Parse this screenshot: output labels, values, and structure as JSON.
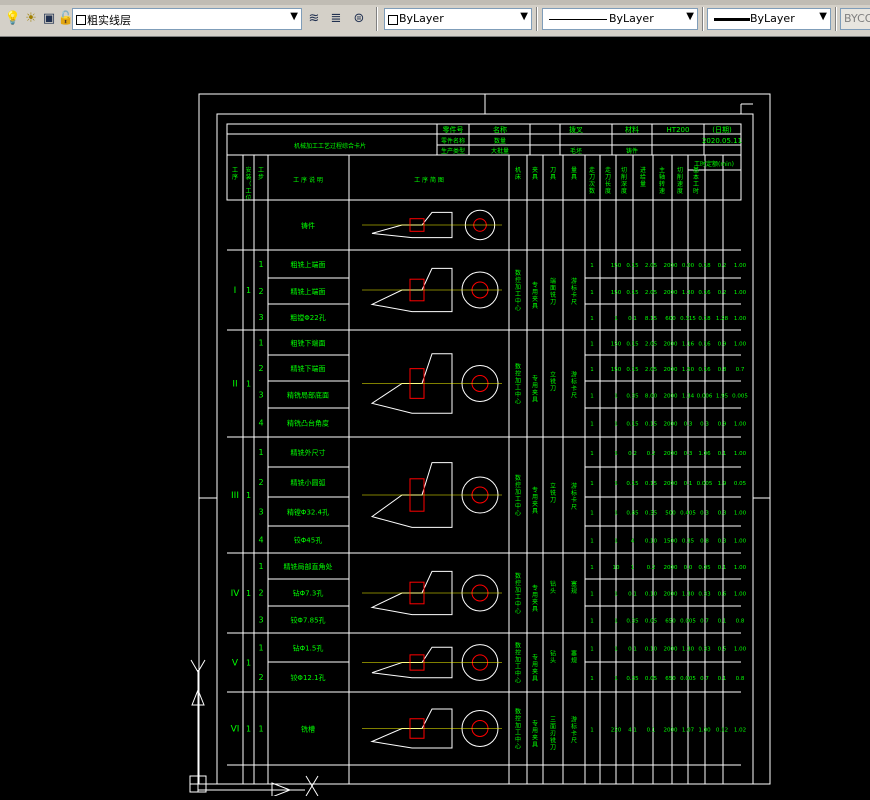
{
  "toolbar": {
    "layer_name": "粗实线层",
    "color_value": "ByLayer",
    "linetype_value": "ByLayer",
    "lineweight_value": "ByLayer",
    "plotstyle_value": "BYCOL",
    "icons": [
      "lightbulb-icon",
      "sun-icon",
      "freeze-viewport-icon",
      "lock-icon",
      "color-swatch-icon",
      "layer-properties-icon",
      "layer-previous-icon",
      "make-current-icon"
    ]
  },
  "drawing": {
    "info_box": {
      "r1": [
        "零件号",
        "名称",
        "拨叉",
        "材料",
        "HT200",
        "(日期)"
      ],
      "r2": [
        "零件名称",
        "数量",
        "2020.05.11"
      ],
      "r3": [
        "生产类型",
        "大批量",
        "毛坯",
        "铸件"
      ]
    },
    "sheet_title": "机械加工工艺过程综合卡片",
    "headers": [
      "工序",
      "安装（工位）",
      "工步",
      "工 序 说 明",
      "工 序 简 图",
      "机床",
      "夹具",
      "刀具",
      "量具",
      "走刀次数",
      "走刀长度",
      "切削深度",
      "进给量",
      "主轴转速",
      "切削速度",
      "基本工时"
    ],
    "time_header": "工时定额(min)",
    "procedures": [
      {
        "op": "",
        "setup": "",
        "steps": [
          {
            "num": "",
            "desc": "铸件"
          }
        ],
        "machine": "",
        "fixture": "",
        "tool": "",
        "gauge": ""
      },
      {
        "op": "I",
        "setup": "1",
        "steps": [
          {
            "num": "1",
            "desc": "粗铣上端面",
            "vals": [
              "1",
              "150",
              "0.15",
              "2.05",
              "2000",
              "0.00",
              "0.18",
              "0.2",
              "1.00"
            ]
          },
          {
            "num": "2",
            "desc": "精铣上端面",
            "vals": [
              "1",
              "150",
              "0.15",
              "2.05",
              "2000",
              "1.30",
              "0.16",
              "0.2",
              "1.00"
            ]
          },
          {
            "num": "3",
            "desc": "粗镗Φ22孔",
            "vals": [
              "1",
              "1",
              "0.1",
              "8.15",
              "600",
              "0.315",
              "0.18",
              "1.28",
              "1.00"
            ]
          }
        ],
        "machine": "数控加工中心",
        "fixture": "专用夹具",
        "tool": "端面铣刀",
        "gauge": "游标卡尺"
      },
      {
        "op": "II",
        "setup": "1",
        "steps": [
          {
            "num": "1",
            "desc": "粗铣下端面",
            "vals": [
              "1",
              "150",
              "0.15",
              "2.05",
              "2000",
              "1.16",
              "0.16",
              "0.9",
              "1.00"
            ]
          },
          {
            "num": "2",
            "desc": "精铣下端面",
            "vals": [
              "1",
              "150",
              "0.15",
              "2.05",
              "2000",
              "1.50",
              "0.16",
              "0.8",
              "0.7"
            ]
          },
          {
            "num": "3",
            "desc": "精铣局部底面",
            "vals": [
              "1",
              "1",
              "0.35",
              "8.00",
              "2000",
              "1.34",
              "0.006",
              "1.95",
              "0.005"
            ]
          },
          {
            "num": "4",
            "desc": "精铣凸台角度",
            "vals": [
              "1",
              "1",
              "0.15",
              "0.15",
              "2000",
              "0.3",
              "0.3",
              "0.9",
              "1.00"
            ]
          }
        ],
        "machine": "数控加工中心",
        "fixture": "专用夹具",
        "tool": "立铣刀",
        "gauge": "游标卡尺"
      },
      {
        "op": "III",
        "setup": "1",
        "steps": [
          {
            "num": "1",
            "desc": "精铣外尺寸",
            "vals": [
              "1",
              "1",
              "0.2",
              "0.2",
              "2000",
              "0.3",
              "1.06",
              "0.1",
              "1.00"
            ]
          },
          {
            "num": "2",
            "desc": "精铣小圆弧",
            "vals": [
              "1",
              "1",
              "0.15",
              "0.15",
              "2000",
              "0.1",
              "0.005",
              "1.9",
              "0.05"
            ]
          },
          {
            "num": "3",
            "desc": "精镗Φ32.4孔",
            "vals": [
              "1",
              "1",
              "0.45",
              "0.35",
              "500",
              "0.405",
              "0.3",
              "0.3",
              "1.00"
            ]
          },
          {
            "num": "4",
            "desc": "铰Φ45孔",
            "vals": [
              "1",
              "1",
              "4",
              "0.10",
              "1500",
              "0.35",
              "0.8",
              "0.3",
              "1.00"
            ]
          }
        ],
        "machine": "数控加工中心",
        "fixture": "专用夹具",
        "tool": "立铣刀",
        "gauge": "游标卡尺"
      },
      {
        "op": "IV",
        "setup": "1",
        "steps": [
          {
            "num": "1",
            "desc": "精铣局部直角处",
            "vals": [
              "1",
              "10",
              "1",
              "0.2",
              "2000",
              "0.0",
              "0.05",
              "0.1",
              "1.00"
            ]
          },
          {
            "num": "2",
            "desc": "钻Φ7.3孔",
            "vals": [
              "1",
              "1",
              "0.1",
              "0.10",
              "2000",
              "1.30",
              "0.33",
              "0.6",
              "1.00"
            ]
          },
          {
            "num": "3",
            "desc": "铰Φ7.85孔",
            "vals": [
              "1",
              "1",
              "0.35",
              "0.05",
              "650",
              "0.005",
              "0.7",
              "0.1",
              "0.8"
            ]
          }
        ],
        "machine": "数控加工中心",
        "fixture": "专用夹具",
        "tool": "钻头",
        "gauge": "塞规"
      },
      {
        "op": "V",
        "setup": "1",
        "steps": [
          {
            "num": "1",
            "desc": "钻Φ1.5孔",
            "vals": [
              "1",
              "1",
              "0.1",
              "0.10",
              "2000",
              "1.30",
              "0.33",
              "0.5",
              "1.00"
            ]
          },
          {
            "num": "2",
            "desc": "铰Φ12.1孔",
            "vals": [
              "1",
              "1",
              "0.35",
              "0.05",
              "650",
              "0.005",
              "0.7",
              "0.1",
              "0.8"
            ]
          }
        ],
        "machine": "数控加工中心",
        "fixture": "专用夹具",
        "tool": "钻头",
        "gauge": "塞规"
      },
      {
        "op": "VI",
        "setup": "1",
        "steps": [
          {
            "num": "1",
            "desc": "铣槽",
            "vals": [
              "1",
              "220",
              "4.1",
              "0.1",
              "2000",
              "1.07",
              "1.00",
              "0.12",
              "1.02"
            ]
          }
        ],
        "machine": "数控加工中心",
        "fixture": "专用夹具",
        "tool": "三面刃铣刀",
        "gauge": "游标卡尺"
      }
    ]
  },
  "colors": {
    "toolbar_bg": "#d4d0c8",
    "canvas_bg": "#000000",
    "frame": "#ffffff",
    "text": "#00ff00",
    "sketch": "#ffffff",
    "highlight": "#ff0000",
    "accent": "#ffff00"
  }
}
